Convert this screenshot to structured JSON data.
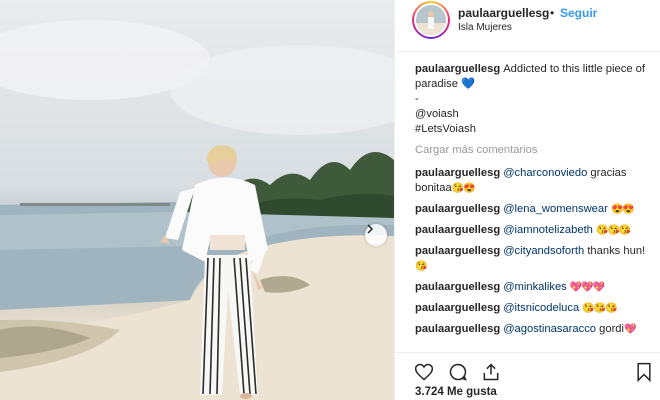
{
  "post": {
    "username": "paulaarguellesg",
    "separator": "•",
    "follow_label": "Seguir",
    "location": "Isla Mujeres",
    "likes": "3.724 Me gusta"
  },
  "caption": {
    "username": "paulaarguellesg",
    "text": "Addicted to this little piece of paradise",
    "emoji": "💙",
    "dash": "-",
    "mention": "@voiash",
    "hashtag": "#LetsVoiash"
  },
  "load_more_label": "Cargar más comentarios",
  "comments": [
    {
      "user": "paulaarguellesg",
      "mention": "@charconoviedo",
      "text": "gracias bonitaa",
      "emoji": "😘😍"
    },
    {
      "user": "paulaarguellesg",
      "mention": "@lena_womenswear",
      "text": "",
      "emoji": "😍😍"
    },
    {
      "user": "paulaarguellesg",
      "mention": "@iamnotelizabeth",
      "text": "",
      "emoji": "😘😘😘"
    },
    {
      "user": "paulaarguellesg",
      "mention": "@cityandsoforth",
      "text": "thanks hun!",
      "emoji": "😘"
    },
    {
      "user": "paulaarguellesg",
      "mention": "@minkalikes",
      "text": "",
      "emoji": "💖💖💖"
    },
    {
      "user": "paulaarguellesg",
      "mention": "@itsnicodeluca",
      "text": "",
      "emoji": "😘😘😘"
    },
    {
      "user": "paulaarguellesg",
      "mention": "@agostinasaracco",
      "text": "gordi",
      "emoji": "💖"
    }
  ],
  "icons": {
    "like": "heart-icon",
    "comment": "comment-icon",
    "share": "share-icon",
    "save": "bookmark-icon",
    "next": "chevron-right-icon"
  },
  "colors": {
    "link_blue": "#3897f0",
    "tag_blue": "#003569",
    "muted": "#999999"
  }
}
